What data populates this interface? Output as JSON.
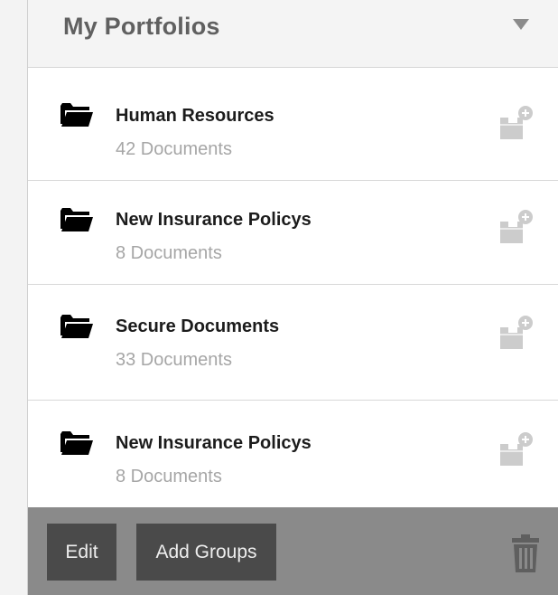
{
  "header": {
    "title": "My Portfolios"
  },
  "portfolios": [
    {
      "name": "Human Resources",
      "count": "42 Documents"
    },
    {
      "name": "New Insurance Policys",
      "count": "8 Documents"
    },
    {
      "name": "Secure Documents",
      "count": "33 Documents"
    },
    {
      "name": "New Insurance Policys",
      "count": "8 Documents"
    }
  ],
  "footer": {
    "edit_label": "Edit",
    "add_groups_label": "Add Groups"
  },
  "icons": {
    "folder": "folder-icon",
    "add_to_inbox": "inbox-add-icon",
    "dropdown": "caret-down-icon",
    "delete": "trash-icon"
  },
  "colors": {
    "header_bg": "#f4f4f4",
    "title_text": "#606060",
    "name_text": "#1c1c1c",
    "count_text": "#a6a6a6",
    "icon_gray": "#cccccc",
    "footer_bg": "#8a8a8a",
    "button_bg": "#4a4a4a",
    "trash_gray": "#5f5f5f"
  }
}
